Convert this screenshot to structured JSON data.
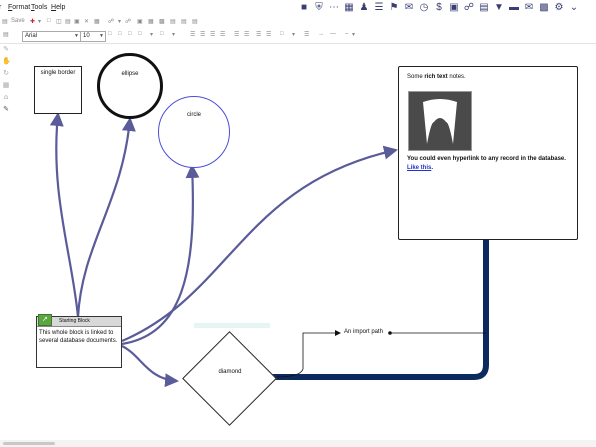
{
  "menu": {
    "format": "Format",
    "format_key": "F",
    "format_rest": "ormat",
    "tools": "Tools",
    "tools_key": "T",
    "tools_rest": "ools",
    "help": "Help",
    "help_key": "H",
    "help_rest": "elp",
    "leading": "r"
  },
  "toolbar": {
    "save_label": "Save"
  },
  "format_bar": {
    "font": "Arial",
    "size": "10"
  },
  "nodes": {
    "single_border": "single border",
    "ellipse": "ellipse",
    "circle": "circle",
    "starting_block_title": "Starting Block",
    "starting_block_body": "This whole block is linked to several database documents.",
    "diamond": "diamond",
    "rich_note_pre": "Some ",
    "rich_note_bold": "rich text",
    "rich_note_post": " notes.",
    "rich_note_link_text": "You could even hyperlink to any record in the database.",
    "rich_note_link": "Like this",
    "rich_note_end": ".",
    "import_path": "An import path"
  },
  "colors": {
    "arrow": "#5a5b99",
    "thick_link": "#0c2a5e",
    "circle_border": "#4d4fd6",
    "accent": "#3a3f73"
  },
  "icons": [
    "shield-icon",
    "more-icon",
    "calculator-icon",
    "people-icon",
    "tree-icon",
    "flag-icon",
    "comment-icon",
    "clock-icon",
    "dollar-icon",
    "calendar-icon",
    "link-icon",
    "document-icon",
    "pin-icon",
    "inbox-icon",
    "mail-icon",
    "chart-icon",
    "gear-icon",
    "chevron-down-icon"
  ]
}
